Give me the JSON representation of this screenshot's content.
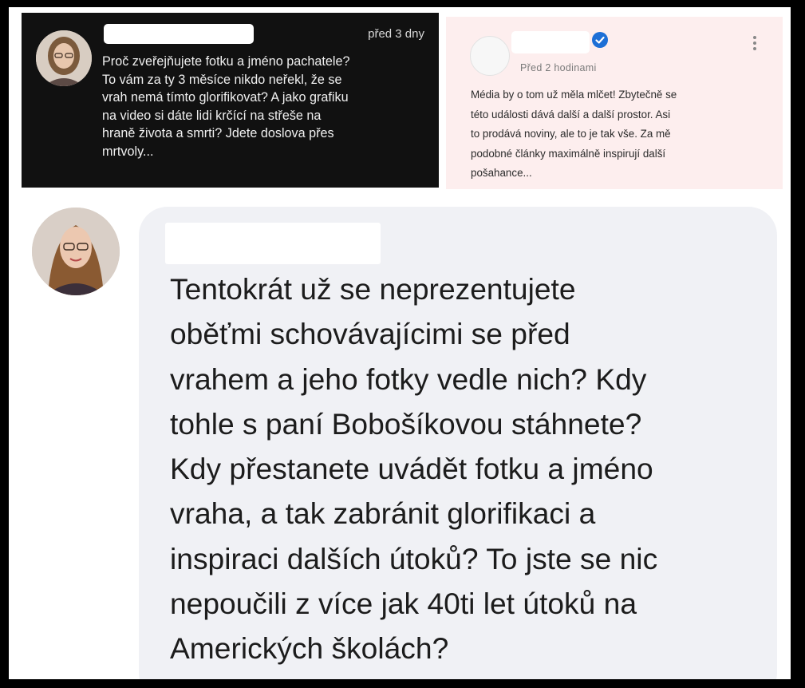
{
  "comment_top_left": {
    "time": "před 3 dny",
    "lines": [
      "Proč zveřejňujete fotku a jméno pachatele?",
      "To vám za ty 3 měsíce nikdo neřekl, že se",
      "vrah nemá tímto glorifikovat? A jako grafiku",
      "na video si dáte lidi krčící na střeše na",
      "hraně života a smrti? Jdete doslova přes",
      "mrtvoly..."
    ]
  },
  "comment_top_right": {
    "time": "Před 2 hodinami",
    "lines": [
      "Média by o tom už měla mlčet! Zbytečně se",
      "této události dává další a další prostor. Asi",
      "to prodává noviny, ale to je tak vše. Za mě",
      "podobné články maximálně inspirují další",
      "pošahance..."
    ],
    "icons": {
      "verified": "verified-badge-icon",
      "more": "more-vertical-icon"
    },
    "accent_color": "#1d6fd6"
  },
  "comment_main": {
    "lines": [
      "Tentokrát už se neprezentujete",
      "oběťmi schovávajícimi se před",
      "vrahem a jeho fotky vedle nich? Kdy",
      "tohle s paní Bobošíkovou stáhnete?",
      "Kdy přestanete uvádět fotku a jméno",
      "vraha, a tak zabránit glorifikaci a",
      "inspiraci dalších útoků? To jste se nic",
      "nepoučili z více jak 40ti let útoků na",
      "Amerických školách?"
    ]
  }
}
